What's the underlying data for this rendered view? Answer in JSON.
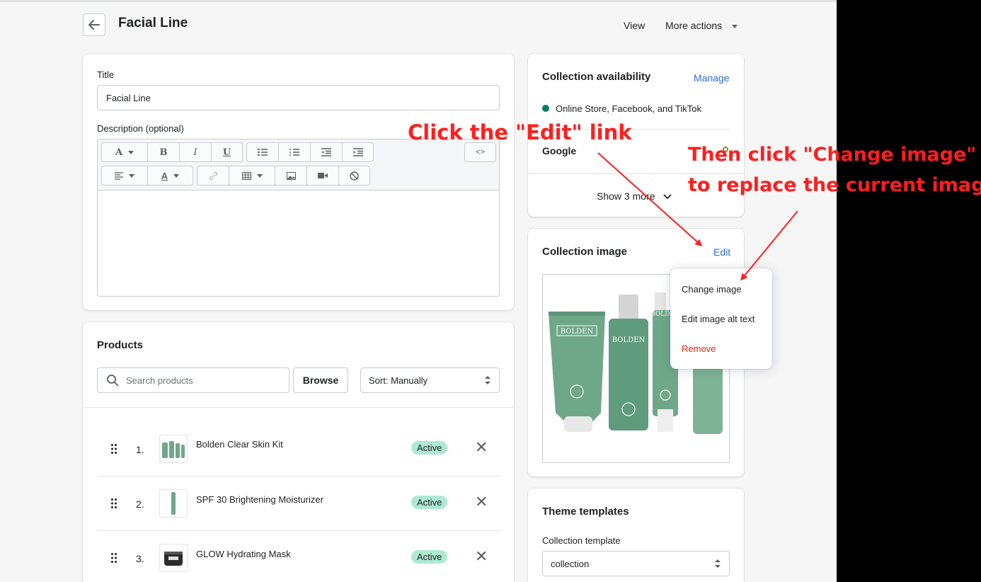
{
  "header": {
    "title": "Facial Line",
    "view_label": "View",
    "more_actions_label": "More actions"
  },
  "details": {
    "title_label": "Title",
    "title_value": "Facial Line",
    "description_label": "Description (optional)",
    "toolbar_row1": [
      "font-icon",
      "bold-icon",
      "italic-icon",
      "underline-icon",
      "bullet-list-icon",
      "numbered-list-icon",
      "outdent-icon",
      "indent-icon",
      "code-icon"
    ],
    "toolbar_row2": [
      "align-icon",
      "text-color-icon",
      "link-icon",
      "table-icon",
      "image-icon",
      "video-icon",
      "clear-format-icon"
    ]
  },
  "products": {
    "title": "Products",
    "search_placeholder": "Search products",
    "browse_label": "Browse",
    "sort_label": "Sort: Manually",
    "items": [
      {
        "num": "1.",
        "name": "Bolden Clear Skin Kit",
        "status": "Active"
      },
      {
        "num": "2.",
        "name": "SPF 30 Brightening Moisturizer",
        "status": "Active"
      },
      {
        "num": "3.",
        "name": "GLOW Hydrating Mask",
        "status": "Active"
      }
    ]
  },
  "availability": {
    "title": "Collection availability",
    "manage_label": "Manage",
    "channels_text": "Online Store, Facebook, and TikTok",
    "google_label": "Google",
    "show_more_label": "Show 3 more",
    "status_color": "#007f5f"
  },
  "collection_image": {
    "title": "Collection image",
    "edit_label": "Edit",
    "product_labels": [
      "BOLDEN",
      "BOLDEN",
      "BOLDEN"
    ],
    "menu": {
      "change_image": "Change image",
      "edit_alt": "Edit image alt text",
      "remove": "Remove"
    },
    "remove_color": "#d72c0d"
  },
  "theme": {
    "title": "Theme templates",
    "template_label": "Collection template",
    "template_value": "collection"
  },
  "annotations": {
    "step1": "Click the \"Edit\" link",
    "step2_line1": "Then click \"Change image\"",
    "step2_line2": "to replace the current image",
    "color": "#ff1e1e"
  }
}
